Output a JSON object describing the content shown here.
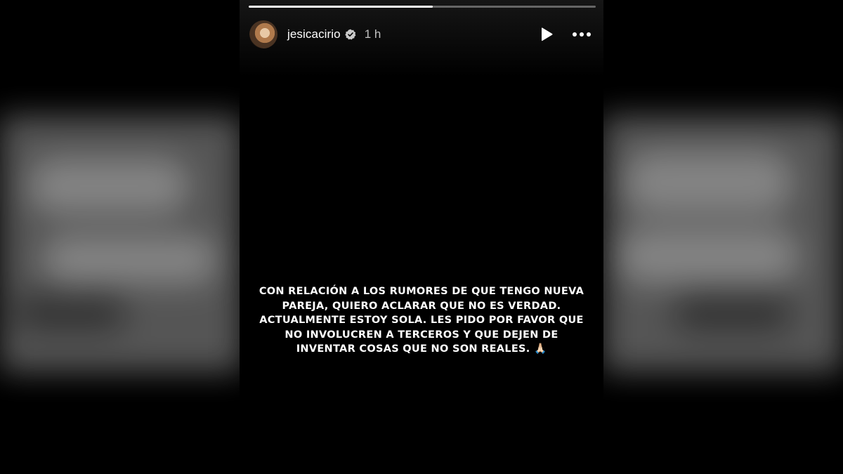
{
  "story": {
    "progress_fraction": 0.53,
    "username": "jesicacirio",
    "verified": true,
    "time_ago": "1 h",
    "icons": {
      "avatar": "profile-avatar",
      "verified": "verified-badge-icon",
      "play": "play-icon",
      "more": "more-options-icon"
    },
    "text_lines": [
      "CON RELACIÓN A LOS RUMORES DE QUE TENGO NUEVA",
      "PAREJA, QUIERO ACLARAR QUE NO ES VERDAD.",
      "ACTUALMENTE ESTOY SOLA. LES PIDO POR FAVOR QUE",
      "NO INVOLUCREN A TERCEROS Y QUE DEJEN DE",
      "INVENTAR COSAS QUE NO SON REALES. 🙏🏻"
    ]
  },
  "colors": {
    "background": "#000000",
    "text": "#ffffff",
    "backdrop": "#5a5a5a"
  }
}
